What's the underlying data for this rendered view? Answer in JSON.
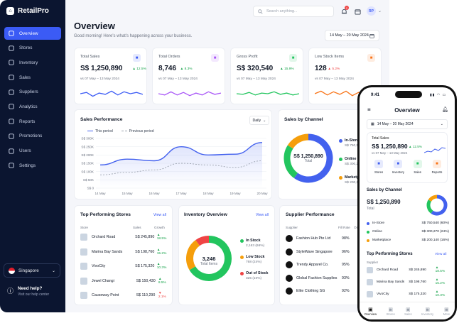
{
  "app": {
    "name": "RetailPro"
  },
  "sidebar": {
    "items": [
      {
        "label": "Overview",
        "icon": "grid-icon",
        "active": true
      },
      {
        "label": "Stores",
        "icon": "store-icon"
      },
      {
        "label": "Inventory",
        "icon": "box-icon"
      },
      {
        "label": "Sales",
        "icon": "cart-icon"
      },
      {
        "label": "Suppliers",
        "icon": "users-icon"
      },
      {
        "label": "Analytics",
        "icon": "bar-chart-icon"
      },
      {
        "label": "Reports",
        "icon": "document-icon"
      },
      {
        "label": "Promotions",
        "icon": "tag-icon"
      },
      {
        "label": "Users",
        "icon": "user-icon"
      },
      {
        "label": "Settings",
        "icon": "gear-icon"
      }
    ],
    "country": "Singapore",
    "help_title": "Need help?",
    "help_sub": "Visit our help center"
  },
  "topbar": {
    "search_placeholder": "Search anything...",
    "notification_count": "2",
    "avatar_initials": "RP"
  },
  "page": {
    "title": "Overview",
    "subtitle": "Good morning! Here's what's happening across your business.",
    "date_range": "14 May – 20 May 2024"
  },
  "kpis": [
    {
      "label": "Total Sales",
      "value": "S$ 1,250,890",
      "change": "▲ 12.5%",
      "positive": true,
      "compare": "vs 07 May – 13 May 2024",
      "color": "#3b5bf5",
      "icon": "dollar-icon",
      "trend": [
        0.5,
        0.4,
        0.7,
        0.45,
        0.55,
        0.3,
        0.6,
        0.35,
        0.5,
        0.4,
        0.55
      ]
    },
    {
      "label": "Total Orders",
      "value": "8,746",
      "change": "▲ 8.3%",
      "positive": true,
      "compare": "vs 07 May – 13 May 2024",
      "color": "#a855f7",
      "icon": "bag-icon",
      "trend": [
        0.5,
        0.6,
        0.35,
        0.6,
        0.4,
        0.65,
        0.45,
        0.6,
        0.35,
        0.55,
        0.45
      ]
    },
    {
      "label": "Gross Profit",
      "value": "S$ 320,540",
      "change": "▲ 15.9%",
      "positive": true,
      "compare": "vs 07 May – 13 May 2024",
      "color": "#22c55e",
      "icon": "wallet-icon",
      "trend": [
        0.5,
        0.55,
        0.4,
        0.6,
        0.45,
        0.5,
        0.35,
        0.55,
        0.45,
        0.6,
        0.5
      ]
    },
    {
      "label": "Low Stock Items",
      "value": "128",
      "change": "▲ 5.2%",
      "positive": false,
      "compare": "vs 07 May – 13 May 2024",
      "color": "#f97316",
      "icon": "alert-icon",
      "trend": [
        0.5,
        0.3,
        0.6,
        0.35,
        0.55,
        0.3,
        0.65,
        0.4,
        0.6,
        0.35,
        0.5
      ]
    }
  ],
  "sales_performance": {
    "title": "Sales Performance",
    "period": "Daily",
    "legend": [
      "This period",
      "Previous period"
    ],
    "chart_data": {
      "type": "line",
      "x": [
        "14 May",
        "15 May",
        "16 May",
        "17 May",
        "18 May",
        "19 May",
        "20 May"
      ],
      "series": [
        {
          "name": "This period",
          "values": [
            140,
            175,
            165,
            250,
            200,
            205,
            275
          ]
        },
        {
          "name": "Previous period",
          "values": [
            80,
            95,
            110,
            150,
            140,
            125,
            165
          ]
        }
      ],
      "y_ticks": [
        "S$ 0",
        "S$ 50K",
        "S$ 100K",
        "S$ 150K",
        "S$ 200K",
        "S$ 250K",
        "S$ 300K"
      ],
      "ylim": [
        0,
        300
      ]
    }
  },
  "sales_by_channel": {
    "title": "Sales by Channel",
    "center_value": "S$ 1,250,890",
    "center_label": "Total",
    "chart_data": {
      "type": "pie",
      "categories": [
        "In-Store",
        "Online",
        "Marketplace"
      ],
      "values": [
        750540,
        300270,
        200140
      ],
      "display": [
        "S$ 750,540",
        "S$ 300,270",
        "S$ 200,140"
      ],
      "colors": [
        "#4361ee",
        "#22c55e",
        "#f59e0b"
      ]
    }
  },
  "top_stores": {
    "title": "Top Performing Stores",
    "view_all": "View all",
    "columns": [
      "Store",
      "Sales",
      "Growth"
    ],
    "rows": [
      {
        "name": "Orchard Road",
        "sales": "S$ 245,890",
        "growth": "▲ 18.5%",
        "positive": true
      },
      {
        "name": "Marina Bay Sands",
        "sales": "S$ 198,760",
        "growth": "▲ 15.2%",
        "positive": true
      },
      {
        "name": "VivoCity",
        "sales": "S$ 175,320",
        "growth": "▲ 10.3%",
        "positive": true
      },
      {
        "name": "Jewel Changi",
        "sales": "S$ 150,430",
        "growth": "▲ 8.5%",
        "positive": true
      },
      {
        "name": "Causeway Point",
        "sales": "S$ 110,290",
        "growth": "▼ 2.1%",
        "positive": false
      }
    ]
  },
  "inventory": {
    "title": "Inventory Overview",
    "view_all": "View all",
    "center_value": "3,246",
    "center_label": "Total Items",
    "chart_data": {
      "type": "pie",
      "categories": [
        "In Stock",
        "Low Stock",
        "Out of Stock"
      ],
      "values": [
        2163,
        768,
        325
      ],
      "display": [
        "2,163 (66%)",
        "768 (24%)",
        "325 (10%)"
      ],
      "colors": [
        "#22c55e",
        "#f59e0b",
        "#ef4444"
      ]
    }
  },
  "suppliers": {
    "title": "Supplier Performance",
    "columns": [
      "Supplier",
      "Fill Rate",
      "On-"
    ],
    "rows": [
      {
        "name": "Fashion Hub Pte Ltd",
        "rate": "98%"
      },
      {
        "name": "StyleWave Singapore",
        "rate": "96%"
      },
      {
        "name": "Trendy Apparel Co.",
        "rate": "95%"
      },
      {
        "name": "Global Fashion Supplies",
        "rate": "93%"
      },
      {
        "name": "Elite Clothing SG",
        "rate": "92%"
      }
    ]
  },
  "phone": {
    "time": "9:41",
    "title": "Overview",
    "date_range": "14 May – 20 May 2024",
    "total_sales_label": "Total Sales",
    "total_sales_value": "S$ 1,250,890",
    "total_sales_change": "▲ 12.5%",
    "total_sales_compare": "vs 07 May – 13 May 2024",
    "quick_actions": [
      "Stores",
      "Inventory",
      "Sales",
      "Reports"
    ],
    "channel_title": "Sales by Channel",
    "channel_total": "S$ 1,250,890",
    "channel_total_label": "Total",
    "channels": [
      {
        "name": "In-Store",
        "value": "S$ 750,540 (60%)"
      },
      {
        "name": "Online",
        "value": "S$ 300,270 (24%)"
      },
      {
        "name": "Marketplace",
        "value": "S$ 200,140 (16%)"
      }
    ],
    "stores_title": "Top Performing Stores",
    "stores_view_all": "View all",
    "stores_col": "Supplier",
    "stores": [
      {
        "name": "Orchard Road",
        "sales": "S$ 245,890",
        "growth": "▲ 18.5%"
      },
      {
        "name": "Marina Bay Sands",
        "sales": "S$ 198,760",
        "growth": "▲ 15.2%"
      },
      {
        "name": "VivoCity",
        "sales": "S$ 175,320",
        "growth": "▲ 10.3%"
      }
    ],
    "tabs": [
      "Overview",
      "Stores",
      "Sales",
      "Inventory",
      "More"
    ]
  }
}
